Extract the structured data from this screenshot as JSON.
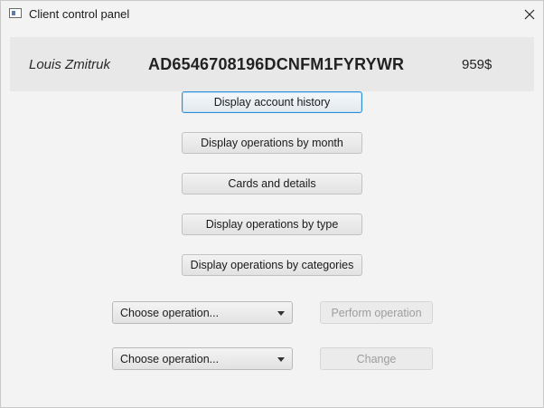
{
  "window": {
    "title": "Client control panel"
  },
  "client": {
    "name": "Louis Zmitruk",
    "iban": "AD6546708196DCNFM1FYRYWR",
    "balance": "959$"
  },
  "actions": {
    "account_history": "Display account history",
    "by_month": "Display operations by month",
    "cards": "Cards and details",
    "by_type": "Display operations by type",
    "by_categories": "Display operations by categories"
  },
  "operation_row_1": {
    "select_value": "Choose operation...",
    "button_label": "Perform operation",
    "button_enabled": false
  },
  "operation_row_2": {
    "select_value": "Choose operation...",
    "button_label": "Change",
    "button_enabled": false
  },
  "colors": {
    "window_bg": "#f3f3f3",
    "header_bg": "#e8e8e8",
    "focus_accent": "#2f8fd6"
  }
}
